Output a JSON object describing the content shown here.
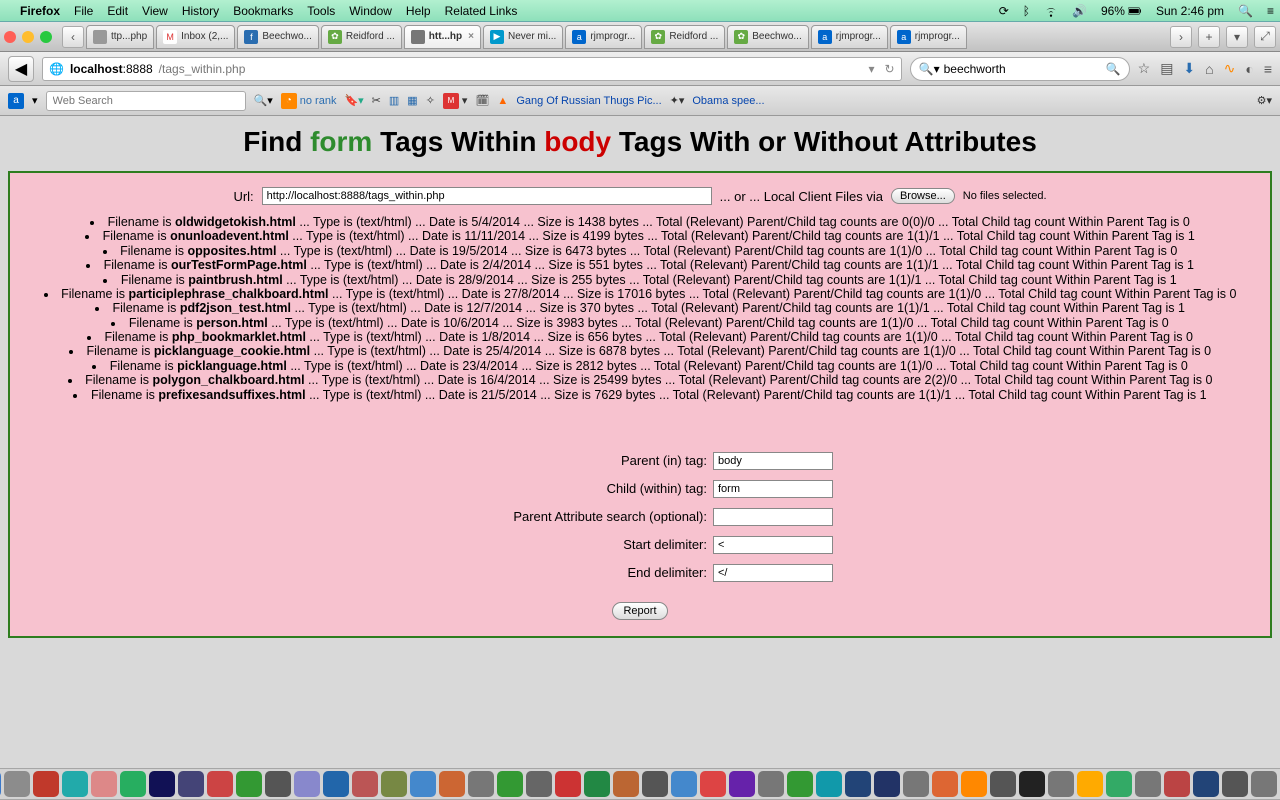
{
  "menubar": {
    "app": "Firefox",
    "items": [
      "File",
      "Edit",
      "View",
      "History",
      "Bookmarks",
      "Tools",
      "Window",
      "Help",
      "Related Links"
    ],
    "battery": "96%",
    "clock": "Sun 2:46 pm"
  },
  "tabs": [
    {
      "label": "ttp...php",
      "favbg": "#999",
      "favtxt": ""
    },
    {
      "label": "Inbox (2,...",
      "favbg": "#fff",
      "favtxt": "M",
      "favcolor": "#d33"
    },
    {
      "label": "Beechwo...",
      "favbg": "#2a6db0",
      "favtxt": "f"
    },
    {
      "label": "Reidford ...",
      "favbg": "#6a4",
      "favtxt": "✿"
    },
    {
      "label": "htt...hp",
      "favbg": "#777",
      "favtxt": "",
      "active": true
    },
    {
      "label": "Never mi...",
      "favbg": "#09c",
      "favtxt": "▶"
    },
    {
      "label": "rjmprogr...",
      "favbg": "#06c",
      "favtxt": "a"
    },
    {
      "label": "Reidford ...",
      "favbg": "#6a4",
      "favtxt": "✿"
    },
    {
      "label": "Beechwo...",
      "favbg": "#6a4",
      "favtxt": "✿"
    },
    {
      "label": "rjmprogr...",
      "favbg": "#06c",
      "favtxt": "a"
    },
    {
      "label": "rjmprogr...",
      "favbg": "#06c",
      "favtxt": "a"
    }
  ],
  "address": {
    "host": "localhost",
    "port": ":8888",
    "path": "/tags_within.php"
  },
  "search": {
    "value": "beechworth"
  },
  "bookmarktoolbar": {
    "websearch_placeholder": "Web Search",
    "norank": "no rank",
    "link1": "Gang Of Russian Thugs Pic...",
    "link2": "Obama spee..."
  },
  "page": {
    "title_pre": "Find ",
    "title_form": "form",
    "title_mid": " Tags Within ",
    "title_body": "body",
    "title_post": " Tags With or Without Attributes",
    "url_label": "Url:",
    "url_value": "http://localhost:8888/tags_within.php",
    "or_text": "... or ... Local Client Files via",
    "browse": "Browse...",
    "nofiles": "No files selected.",
    "files": [
      {
        "name": "oldwidgetokish.html",
        "date": "5/4/2014",
        "size": "1438",
        "pc": "0(0)/0",
        "within": "0"
      },
      {
        "name": "onunloadevent.html",
        "date": "11/11/2014",
        "size": "4199",
        "pc": "1(1)/1",
        "within": "1"
      },
      {
        "name": "opposites.html",
        "date": "19/5/2014",
        "size": "6473",
        "pc": "1(1)/0",
        "within": "0"
      },
      {
        "name": "ourTestFormPage.html",
        "date": "2/4/2014",
        "size": "551",
        "pc": "1(1)/1",
        "within": "1"
      },
      {
        "name": "paintbrush.html",
        "date": "28/9/2014",
        "size": "255",
        "pc": "1(1)/1",
        "within": "1"
      },
      {
        "name": "participlephrase_chalkboard.html",
        "date": "27/8/2014",
        "size": "17016",
        "pc": "1(1)/0",
        "within": "0"
      },
      {
        "name": "pdf2json_test.html",
        "date": "12/7/2014",
        "size": "370",
        "pc": "1(1)/1",
        "within": "1"
      },
      {
        "name": "person.html",
        "date": "10/6/2014",
        "size": "3983",
        "pc": "1(1)/0",
        "within": "0"
      },
      {
        "name": "php_bookmarklet.html",
        "date": "1/8/2014",
        "size": "656",
        "pc": "1(1)/0",
        "within": "0"
      },
      {
        "name": "picklanguage_cookie.html",
        "date": "25/4/2014",
        "size": "6878",
        "pc": "1(1)/0",
        "within": "0"
      },
      {
        "name": "picklanguage.html",
        "date": "23/4/2014",
        "size": "2812",
        "pc": "1(1)/0",
        "within": "0"
      },
      {
        "name": "polygon_chalkboard.html",
        "date": "16/4/2014",
        "size": "25499",
        "pc": "2(2)/0",
        "within": "0"
      },
      {
        "name": "prefixesandsuffixes.html",
        "date": "21/5/2014",
        "size": "7629",
        "pc": "1(1)/1",
        "within": "1"
      }
    ],
    "labels": {
      "parent": "Parent (in) tag:",
      "child": "Child (within) tag:",
      "pattr": "Parent Attribute search (optional):",
      "sdel": "Start delimiter:",
      "edel": "End delimiter:"
    },
    "values": {
      "parent": "body",
      "child": "form",
      "pattr": "",
      "sdel": "<",
      "edel": "</"
    },
    "report": "Report"
  },
  "dock_colors": [
    "#3a78c9",
    "#8c8c8c",
    "#c0392b",
    "#2aa",
    "#d88",
    "#27ae60",
    "#115",
    "#447",
    "#c44",
    "#393",
    "#555",
    "#88c",
    "#26a",
    "#b55",
    "#784",
    "#48c",
    "#c63",
    "#777",
    "#393",
    "#666",
    "#c33",
    "#284",
    "#b63",
    "#555",
    "#48c",
    "#d44",
    "#62a",
    "#777",
    "#393",
    "#19a",
    "#247",
    "#236",
    "#777",
    "#d63",
    "#f80",
    "#555",
    "#222",
    "#777",
    "#fa0",
    "#3a6",
    "#777",
    "#b44",
    "#247",
    "#555",
    "#777",
    "#999"
  ]
}
